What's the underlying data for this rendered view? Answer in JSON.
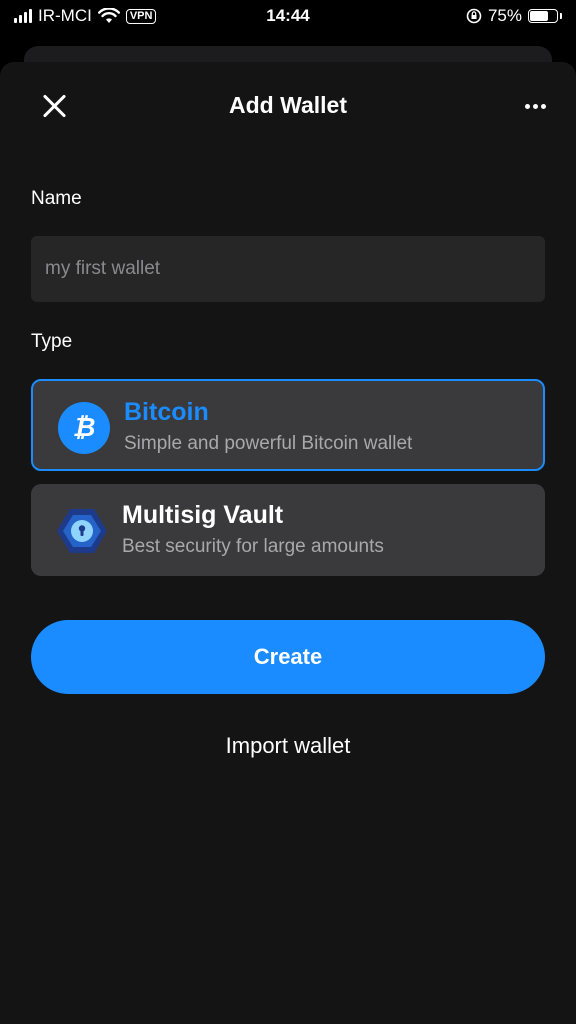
{
  "status_bar": {
    "carrier": "IR-MCI",
    "vpn": "VPN",
    "time": "14:44",
    "battery": "75%",
    "battery_level": 0.75
  },
  "header": {
    "title": "Add Wallet"
  },
  "form": {
    "name_label": "Name",
    "name_placeholder": "my first wallet",
    "name_value": "",
    "type_label": "Type"
  },
  "wallet_types": [
    {
      "title": "Bitcoin",
      "description": "Simple and powerful Bitcoin wallet",
      "icon": "bitcoin-icon",
      "selected": true
    },
    {
      "title": "Multisig Vault",
      "description": "Best security for large amounts",
      "icon": "vault-icon",
      "selected": false
    }
  ],
  "actions": {
    "create_label": "Create",
    "import_label": "Import wallet"
  },
  "colors": {
    "accent": "#1a8cff",
    "background": "#141414",
    "card": "#3a3a3c",
    "input": "#262626"
  }
}
